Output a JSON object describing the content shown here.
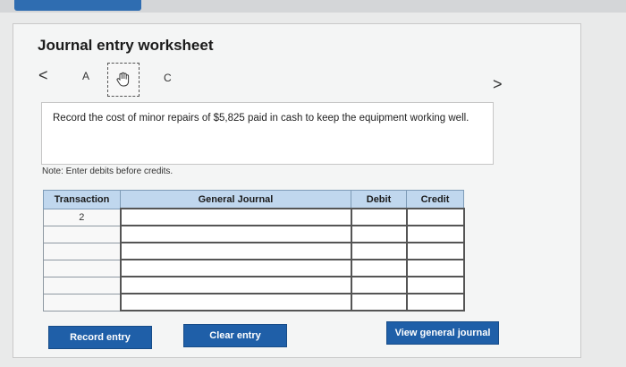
{
  "worksheet": {
    "title": "Journal entry worksheet",
    "nav_prev": "<",
    "nav_next": ">",
    "tabs": [
      {
        "label": "A"
      },
      {
        "label": ""
      },
      {
        "label": "C"
      }
    ],
    "instruction": "Record the cost of minor repairs of $5,825 paid in cash to keep the equipment working well.",
    "note": "Note: Enter debits before credits."
  },
  "table": {
    "headers": {
      "transaction": "Transaction",
      "general_journal": "General Journal",
      "debit": "Debit",
      "credit": "Credit"
    },
    "transaction_number": "2"
  },
  "buttons": {
    "record": "Record entry",
    "clear": "Clear entry",
    "view": "View general journal"
  },
  "icons": {
    "selected_tab_icon": "hand-cursor-icon"
  },
  "colors": {
    "button": "#1f5fa8",
    "header": "#c0d7ee"
  }
}
